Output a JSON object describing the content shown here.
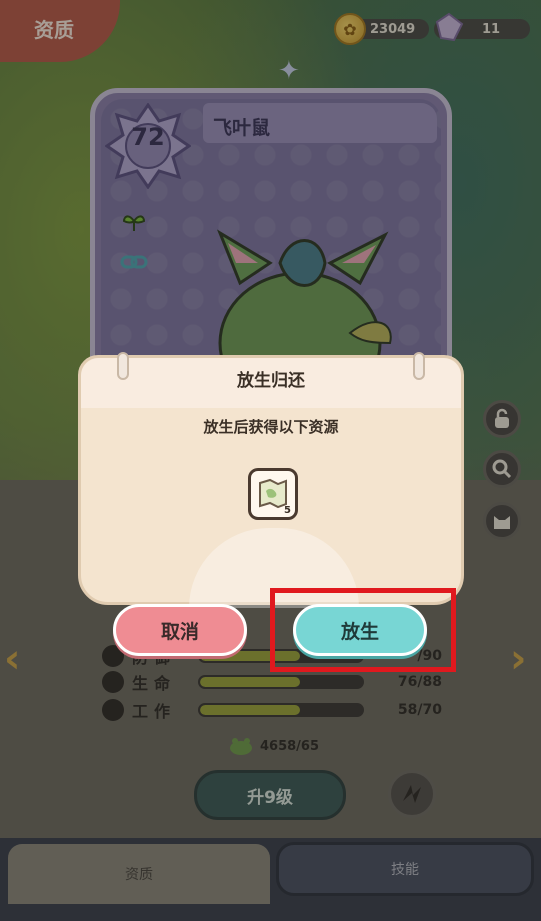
{
  "header": {
    "tab_label": "资质"
  },
  "currency": {
    "coins": "23049",
    "gems": "11"
  },
  "card": {
    "name": "飞叶鼠",
    "level": "72"
  },
  "stats": [
    {
      "label": "防御",
      "value": "/90",
      "fill": 0.62
    },
    {
      "label": "生命",
      "value": "76/88",
      "fill": 0.62
    },
    {
      "label": "工作",
      "value": "58/70",
      "fill": 0.62
    }
  ],
  "exp": {
    "text": "4658/65"
  },
  "upgrade": {
    "label": "升9级"
  },
  "tabs": {
    "aptitude": "资质",
    "skills": "技能"
  },
  "dialog": {
    "title": "放生归还",
    "subtitle": "放生后获得以下资源",
    "reward_count": "5",
    "cancel_label": "取消",
    "confirm_label": "放生"
  },
  "colors": {
    "highlight": "#e0191e",
    "confirm": "#78d6d4",
    "cancel": "#ef8c93"
  }
}
